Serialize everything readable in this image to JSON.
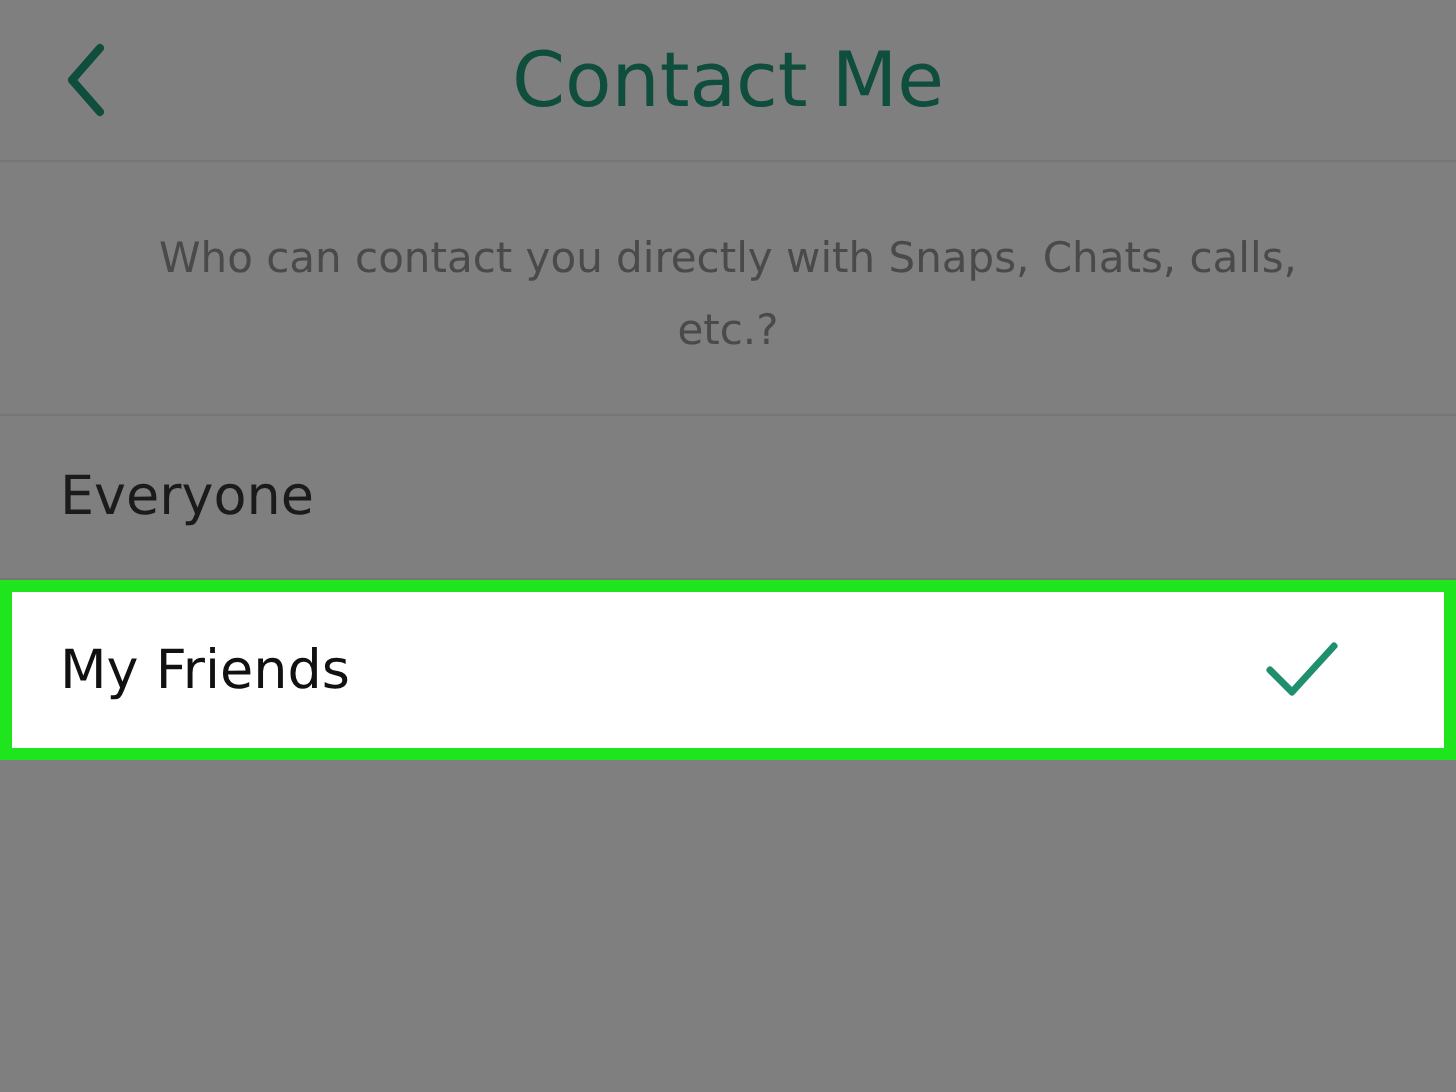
{
  "header": {
    "title": "Contact Me"
  },
  "description": "Who can contact you directly with Snaps, Chats, calls, etc.?",
  "options": [
    {
      "label": "Everyone",
      "selected": false
    },
    {
      "label": "My Friends",
      "selected": true
    }
  ]
}
